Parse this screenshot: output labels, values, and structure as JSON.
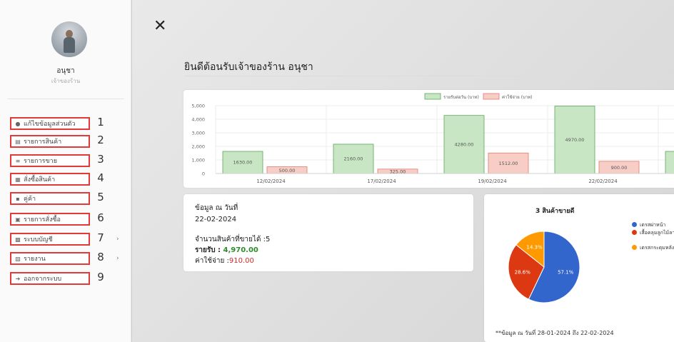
{
  "user": {
    "name": "อนุชา",
    "role": "เจ้าของร้าน"
  },
  "menu": [
    {
      "label": "แก้ไขข้อมูลส่วนตัว",
      "icon": "user-icon",
      "num": "1",
      "submenu": false
    },
    {
      "label": "รายการสินค้า",
      "icon": "list-icon",
      "num": "2",
      "submenu": false
    },
    {
      "label": "รายการขาย",
      "icon": "list-icon",
      "num": "3",
      "submenu": false
    },
    {
      "label": "สั่งซื้อสินค้า",
      "icon": "cart-icon",
      "num": "4",
      "submenu": false
    },
    {
      "label": "คู่ค้า",
      "icon": "truck-icon",
      "num": "5",
      "submenu": false
    },
    {
      "label": "รายการสั่งซื้อ",
      "icon": "order-icon",
      "num": "6",
      "submenu": false
    },
    {
      "label": "ระบบบัญชี",
      "icon": "book-icon",
      "num": "7",
      "submenu": true
    },
    {
      "label": "รายงาน",
      "icon": "report-icon",
      "num": "8",
      "submenu": true
    },
    {
      "label": "ออกจากระบบ",
      "icon": "logout-icon",
      "num": "9",
      "submenu": false
    }
  ],
  "header": {
    "close_symbol": "✕",
    "title": "ยินดีต้อนรับเจ้าของร้าน อนุชา"
  },
  "info": {
    "heading": "ข้อมูล ณ วันที่",
    "date": "22-02-2024",
    "products_sold_label": "จำนวนสินค้าที่ขายได้ :",
    "products_sold": "5",
    "income_label": "รายรับ :",
    "income": "4,970.00",
    "expense_label": "ค่าใช้จ่าย :",
    "expense": "910.00"
  },
  "colors": {
    "income_fill": "#c8e6c4",
    "income_stroke": "#5aa75a",
    "expense_fill": "#f7cdc6",
    "expense_stroke": "#e07d6f",
    "pie": [
      "#3366cc",
      "#dc3912",
      "#ff9900"
    ]
  },
  "chart_data": [
    {
      "type": "bar",
      "categories": [
        "12/02/2024",
        "17/02/2024",
        "19/02/2024",
        "22/02/2024"
      ],
      "series": [
        {
          "name": "รายรับต่อวัน (บาท)",
          "values": [
            1630,
            2160,
            4280,
            4970
          ],
          "labels": [
            "1630.00",
            "2160.00",
            "4280.00",
            "4970.00"
          ]
        },
        {
          "name": "ค่าใช้จ่าย (บาท)",
          "values": [
            500,
            325,
            1512,
            900
          ],
          "labels": [
            "500.00",
            "325.00",
            "1512.00",
            "900.00"
          ]
        }
      ],
      "ylim": [
        0,
        5000
      ],
      "yticks": [
        "0",
        "1,000",
        "2,000",
        "3,000",
        "4,000",
        "5,000"
      ],
      "legend": "top",
      "partial_next_value": 1630
    },
    {
      "type": "pie",
      "title": "3 สินค้าขายดี",
      "slices": [
        {
          "name": "เดรสผ่าหน้า",
          "value": 57.1,
          "label": "57.1%"
        },
        {
          "name": "เสื้อคลุมลูกไม้ลาย 1",
          "value": 28.6,
          "label": "28.6%"
        },
        {
          "name": "เดรสกระดุมหลัง",
          "value": 14.3,
          "label": "14.3%"
        }
      ],
      "legend": "right"
    }
  ],
  "footnote": "**ข้อมูล ณ วันที่ 28-01-2024 ถึง 22-02-2024"
}
